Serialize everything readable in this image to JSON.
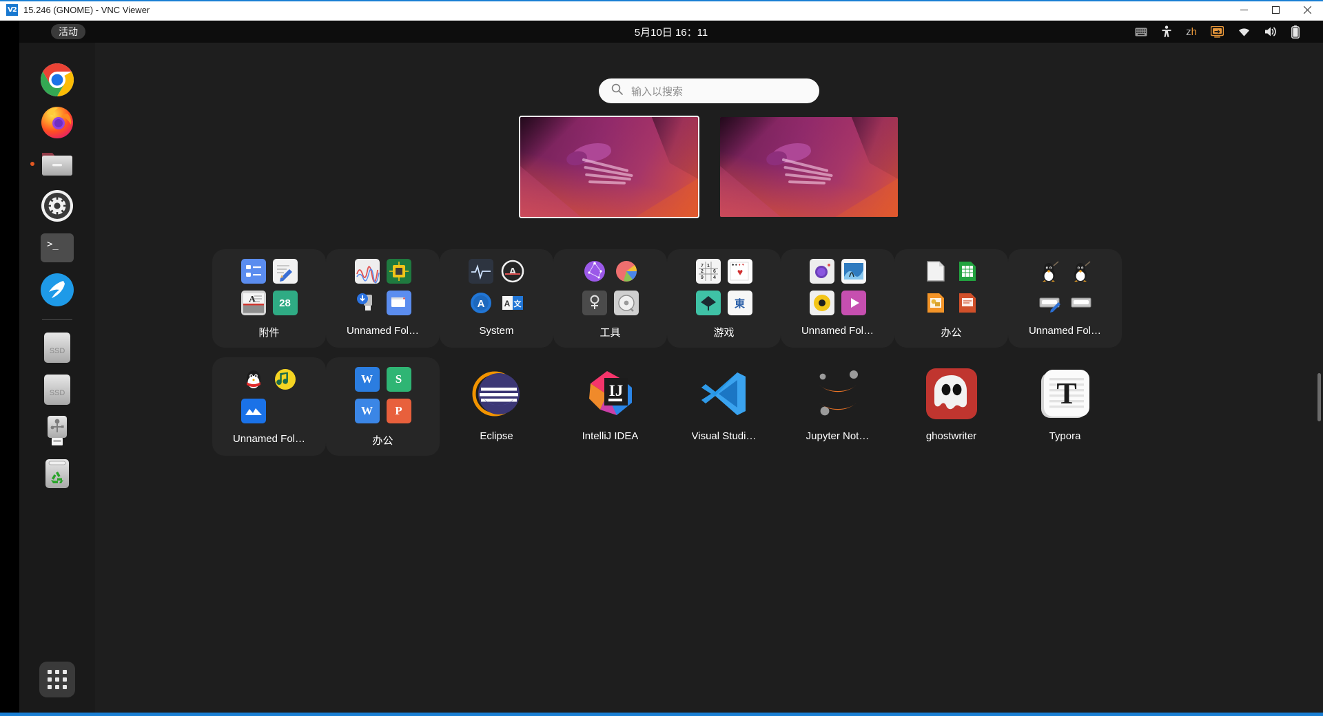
{
  "window": {
    "title": "15.246 (GNOME) - VNC Viewer",
    "logo_text": "V2",
    "controls": {
      "minimize": "—",
      "maximize": "▢",
      "close": "✕"
    }
  },
  "topbar": {
    "activities_label": "活动",
    "clock": "5月10日  16：11",
    "status_icons": [
      {
        "name": "keyboard-icon",
        "label": "keyboard"
      },
      {
        "name": "accessibility-icon",
        "label": "accessibility"
      }
    ],
    "language_indicator": {
      "prefix": "z",
      "suffix": "h",
      "accent": "#e8973a"
    },
    "right_icons": [
      {
        "name": "screen-share-icon",
        "label": "screen sharing"
      },
      {
        "name": "wifi-icon",
        "label": "wifi"
      },
      {
        "name": "volume-icon",
        "label": "volume"
      },
      {
        "name": "battery-icon",
        "label": "battery"
      }
    ]
  },
  "dock": {
    "items": [
      {
        "name": "dock-item-chrome",
        "label": "Google Chrome",
        "running": false
      },
      {
        "name": "dock-item-firefox",
        "label": "Firefox",
        "running": false
      },
      {
        "name": "dock-item-files",
        "label": "Files",
        "running": true
      },
      {
        "name": "dock-item-settings",
        "label": "Settings",
        "running": false
      },
      {
        "name": "dock-item-terminal",
        "label": "Terminal",
        "running": false
      },
      {
        "name": "dock-item-mail",
        "label": "Mail",
        "running": false
      },
      {
        "name": "dock-item-ssd-1",
        "label": "SSD",
        "running": false
      },
      {
        "name": "dock-item-ssd-2",
        "label": "SSD",
        "running": false
      },
      {
        "name": "dock-item-usb",
        "label": "USB Drive",
        "running": false
      },
      {
        "name": "dock-item-trash",
        "label": "Trash",
        "running": false
      }
    ],
    "drive_label": "SSD",
    "show_apps_label": "Show Applications"
  },
  "search": {
    "placeholder": "输入以搜索",
    "value": "",
    "icon": "search-icon"
  },
  "workspaces": [
    {
      "name": "workspace-1",
      "active": true
    },
    {
      "name": "workspace-2",
      "active": false
    }
  ],
  "apps": {
    "row1": [
      {
        "type": "folder",
        "label": "附件",
        "name": "folder-accessories"
      },
      {
        "type": "folder",
        "label": "Unnamed Fol…",
        "name": "folder-unnamed-1"
      },
      {
        "type": "folder",
        "label": "System",
        "name": "folder-system"
      },
      {
        "type": "folder",
        "label": "工具",
        "name": "folder-tools"
      },
      {
        "type": "folder",
        "label": "游戏",
        "name": "folder-games"
      },
      {
        "type": "folder",
        "label": "Unnamed Fol…",
        "name": "folder-unnamed-2"
      },
      {
        "type": "folder",
        "label": "办公",
        "name": "folder-office-libre"
      },
      {
        "type": "folder",
        "label": "Unnamed Fol…",
        "name": "folder-unnamed-3"
      }
    ],
    "row2": [
      {
        "type": "folder",
        "label": "Unnamed Fol…",
        "name": "folder-unnamed-4"
      },
      {
        "type": "folder",
        "label": "办公",
        "name": "folder-office-wps"
      },
      {
        "type": "app",
        "label": "Eclipse",
        "name": "app-eclipse"
      },
      {
        "type": "app",
        "label": "IntelliJ IDEA",
        "name": "app-intellij-idea"
      },
      {
        "type": "app",
        "label": "Visual Studi…",
        "name": "app-visual-studio-code"
      },
      {
        "type": "app",
        "label": "Jupyter Not…",
        "name": "app-jupyter-notebook"
      },
      {
        "type": "app",
        "label": "ghostwriter",
        "name": "app-ghostwriter"
      },
      {
        "type": "app",
        "label": "Typora",
        "name": "app-typora"
      }
    ]
  },
  "colors": {
    "desktop_bg": "#1e1e1e",
    "topbar_bg": "#0d0d0d",
    "dock_bg": "#1a1a1a",
    "folder_bg": "#262626",
    "accent_orange": "#e8973a",
    "running_dot": "#e25822",
    "titlebar_accent": "#1a7fd4"
  }
}
